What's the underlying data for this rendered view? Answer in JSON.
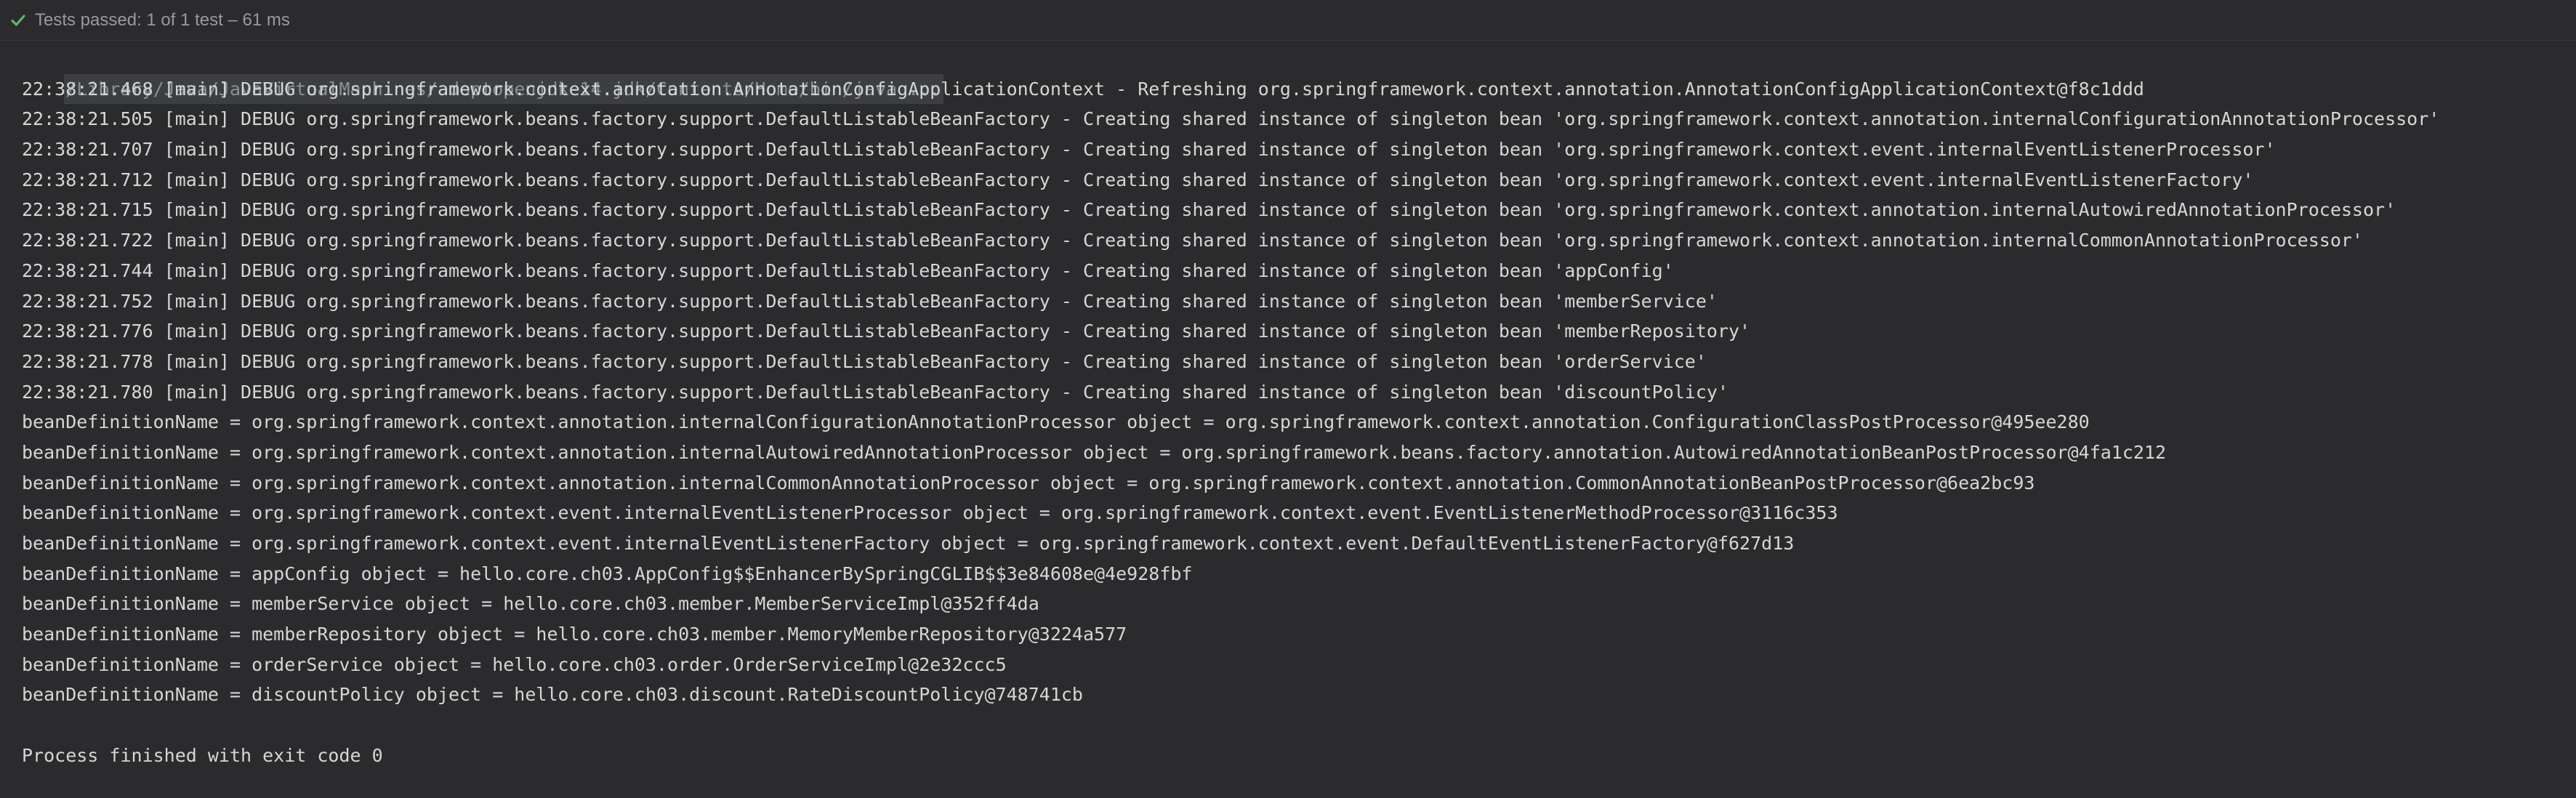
{
  "status": {
    "icon": "check-icon",
    "text": "Tests passed: 1 of 1 test – 61 ms",
    "accent": "#5fb865"
  },
  "console": {
    "command": "/Library/Java/JavaVirtualMachines/adoptopenjdk-14.jdk/Contents/Home/bin/java ...",
    "lines": [
      "22:38:21.468 [main] DEBUG org.springframework.context.annotation.AnnotationConfigApplicationContext - Refreshing org.springframework.context.annotation.AnnotationConfigApplicationContext@f8c1ddd",
      "22:38:21.505 [main] DEBUG org.springframework.beans.factory.support.DefaultListableBeanFactory - Creating shared instance of singleton bean 'org.springframework.context.annotation.internalConfigurationAnnotationProcessor'",
      "22:38:21.707 [main] DEBUG org.springframework.beans.factory.support.DefaultListableBeanFactory - Creating shared instance of singleton bean 'org.springframework.context.event.internalEventListenerProcessor'",
      "22:38:21.712 [main] DEBUG org.springframework.beans.factory.support.DefaultListableBeanFactory - Creating shared instance of singleton bean 'org.springframework.context.event.internalEventListenerFactory'",
      "22:38:21.715 [main] DEBUG org.springframework.beans.factory.support.DefaultListableBeanFactory - Creating shared instance of singleton bean 'org.springframework.context.annotation.internalAutowiredAnnotationProcessor'",
      "22:38:21.722 [main] DEBUG org.springframework.beans.factory.support.DefaultListableBeanFactory - Creating shared instance of singleton bean 'org.springframework.context.annotation.internalCommonAnnotationProcessor'",
      "22:38:21.744 [main] DEBUG org.springframework.beans.factory.support.DefaultListableBeanFactory - Creating shared instance of singleton bean 'appConfig'",
      "22:38:21.752 [main] DEBUG org.springframework.beans.factory.support.DefaultListableBeanFactory - Creating shared instance of singleton bean 'memberService'",
      "22:38:21.776 [main] DEBUG org.springframework.beans.factory.support.DefaultListableBeanFactory - Creating shared instance of singleton bean 'memberRepository'",
      "22:38:21.778 [main] DEBUG org.springframework.beans.factory.support.DefaultListableBeanFactory - Creating shared instance of singleton bean 'orderService'",
      "22:38:21.780 [main] DEBUG org.springframework.beans.factory.support.DefaultListableBeanFactory - Creating shared instance of singleton bean 'discountPolicy'",
      "beanDefinitionName = org.springframework.context.annotation.internalConfigurationAnnotationProcessor object = org.springframework.context.annotation.ConfigurationClassPostProcessor@495ee280",
      "beanDefinitionName = org.springframework.context.annotation.internalAutowiredAnnotationProcessor object = org.springframework.beans.factory.annotation.AutowiredAnnotationBeanPostProcessor@4fa1c212",
      "beanDefinitionName = org.springframework.context.annotation.internalCommonAnnotationProcessor object = org.springframework.context.annotation.CommonAnnotationBeanPostProcessor@6ea2bc93",
      "beanDefinitionName = org.springframework.context.event.internalEventListenerProcessor object = org.springframework.context.event.EventListenerMethodProcessor@3116c353",
      "beanDefinitionName = org.springframework.context.event.internalEventListenerFactory object = org.springframework.context.event.DefaultEventListenerFactory@f627d13",
      "beanDefinitionName = appConfig object = hello.core.ch03.AppConfig$$EnhancerBySpringCGLIB$$3e84608e@4e928fbf",
      "beanDefinitionName = memberService object = hello.core.ch03.member.MemberServiceImpl@352ff4da",
      "beanDefinitionName = memberRepository object = hello.core.ch03.member.MemoryMemberRepository@3224a577",
      "beanDefinitionName = orderService object = hello.core.ch03.order.OrderServiceImpl@2e32ccc5",
      "beanDefinitionName = discountPolicy object = hello.core.ch03.discount.RateDiscountPolicy@748741cb"
    ],
    "exit_message": "Process finished with exit code 0"
  }
}
